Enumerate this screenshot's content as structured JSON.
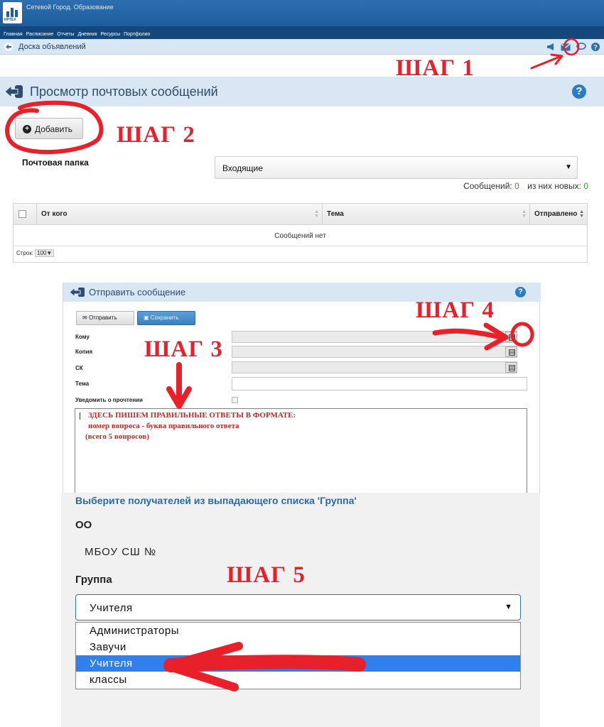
{
  "header": {
    "app_title": "Сетевой Город. Образование",
    "logo_text": "ИРТЕХ"
  },
  "nav": {
    "items": [
      "Главная",
      "Расписание",
      "Отчеты",
      "Дневник",
      "Ресурсы",
      "Портфолио"
    ]
  },
  "subbar": {
    "breadcrumb": "Доска объявлений",
    "icons": [
      "megaphone-icon",
      "mail-icon",
      "chat-icon",
      "help-icon"
    ]
  },
  "steps": {
    "step1": "ШАГ 1",
    "step2": "ШАГ 2",
    "step3": "ШАГ 3",
    "step4": "ШАГ 4",
    "step5": "ШАГ 5"
  },
  "mailbox": {
    "page_title": "Просмотр почтовых сообщений",
    "help_label": "?",
    "add_button": "Добавить",
    "folder_label": "Почтовая папка",
    "folder_value": "Входящие",
    "messages_label": "Сообщений:",
    "messages_count": "0",
    "new_label": "из них новых:",
    "new_count": "0",
    "columns": [
      "От кого",
      "Тема",
      "Отправлено"
    ],
    "empty_text": "Сообщений нет",
    "rows_label": "Строк:",
    "rows_value": "100"
  },
  "compose": {
    "title": "Отправить сообщение",
    "help_label": "?",
    "send_button": "Отправить",
    "save_button": "Сохранить",
    "fields": {
      "to": "Кому",
      "copy": "Копия",
      "bcc": "СК",
      "subject": "Тема",
      "notify": "Уведомить о прочтении"
    },
    "editor_lines": [
      "ЗДЕСЬ ПИШЕМ ПРАВИЛЬНЫЕ ОТВЕТЫ В ФОРМАТЕ:",
      "номер вопроса - буква правильного ответа",
      "(всего 5 вопросов)"
    ]
  },
  "group_picker": {
    "heading": "Выберите получателей из выпадающего списка 'Группа'",
    "oo_label": "ОО",
    "school": "МБОУ СШ №",
    "group_label": "Группа",
    "selected": "Учителя",
    "options": [
      "Администраторы",
      "Завучи",
      "Учителя",
      "классы"
    ],
    "highlighted_index": 2
  },
  "colors": {
    "annotation": "#e8202a",
    "brand": "#1d5d9e",
    "panel": "#d9e6f3",
    "selection": "#2f80ec"
  }
}
